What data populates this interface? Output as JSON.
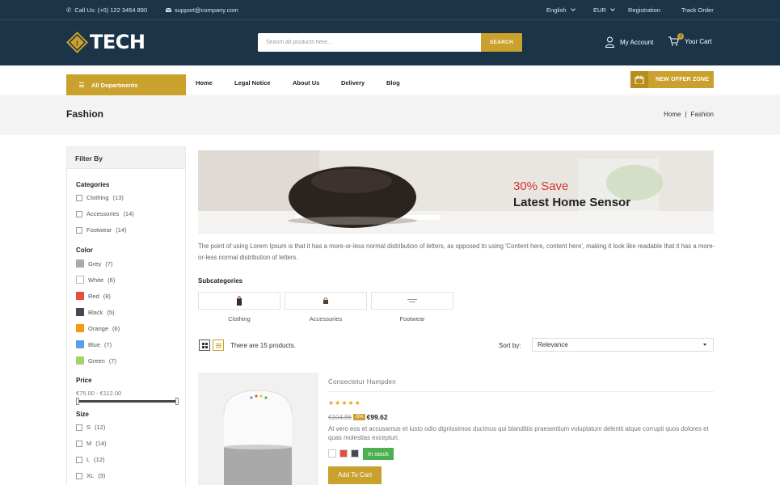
{
  "topbar": {
    "phone": "Call Us: (+0) 122 3454 890",
    "email": "support@company.com",
    "language": "English",
    "currency": "EUR",
    "registration": "Registration",
    "track_order": "Track Order"
  },
  "header": {
    "logo_text": "TECH",
    "search_placeholder": "Search all products here...",
    "search_button": "SEARCH",
    "account": "My Account",
    "cart": "Your Cart",
    "cart_count": "0"
  },
  "nav": {
    "departments": "All Departments",
    "items": [
      "Home",
      "Legal Notice",
      "About Us",
      "Delivery",
      "Blog"
    ],
    "offer": "NEW OFFER ZONE"
  },
  "page": {
    "title": "Fashion",
    "breadcrumb": [
      "Home",
      "Fashion"
    ]
  },
  "filters": {
    "heading": "Filter By",
    "categories_title": "Categories",
    "categories": [
      {
        "label": "Clothing",
        "count": "(13)"
      },
      {
        "label": "Accessories",
        "count": "(14)"
      },
      {
        "label": "Footwear",
        "count": "(14)"
      }
    ],
    "color_title": "Color",
    "colors": [
      {
        "label": "Grey",
        "count": "(7)",
        "hex": "#aaaaaa"
      },
      {
        "label": "White",
        "count": "(6)",
        "hex": "#ffffff"
      },
      {
        "label": "Red",
        "count": "(8)",
        "hex": "#e74c3c"
      },
      {
        "label": "Black",
        "count": "(5)",
        "hex": "#434a54"
      },
      {
        "label": "Orange",
        "count": "(6)",
        "hex": "#f39c11"
      },
      {
        "label": "Blue",
        "count": "(7)",
        "hex": "#5d9cec"
      },
      {
        "label": "Green",
        "count": "(7)",
        "hex": "#a0d468"
      }
    ],
    "price_title": "Price",
    "price_range": "€75.00 - €112.00",
    "size_title": "Size",
    "sizes": [
      {
        "label": "S",
        "count": "(12)"
      },
      {
        "label": "M",
        "count": "(14)"
      },
      {
        "label": "L",
        "count": "(12)"
      },
      {
        "label": "XL",
        "count": "(3)"
      }
    ]
  },
  "banner": {
    "save": "30% Save",
    "title": "Latest Home Sensor"
  },
  "description": "The point of using Lorem Ipsum is that it has a more-or-less normal distribution of letters, as opposed to using 'Content here, content here', making it look like readable that it has a more-or-less normal distribution of letters.",
  "subcategories": {
    "title": "Subcategories",
    "items": [
      "Clothing",
      "Accessories",
      "Footwear"
    ]
  },
  "toolbar": {
    "count": "There are 15 products.",
    "sort_label": "Sort by:",
    "sort_value": "Relevance"
  },
  "product": {
    "name": "Consectetur Hampden",
    "rating": 5,
    "stars": "★★★★★",
    "old_price": "€104.86",
    "discount": "-5%",
    "price": "€99.62",
    "description": "At vero eos et accusamus et iusto odio dignissimos ducimus qui blanditiis praesentium voluptatum deleniti atque corrupti quos dolores et quas molestias excepturi.",
    "colors": [
      "#ffffff",
      "#e74c3c",
      "#434a54"
    ],
    "stock": "In stock",
    "add_to_cart": "Add To Cart"
  },
  "theme": {
    "accent": "#caa12d",
    "navy": "#1c3448"
  }
}
